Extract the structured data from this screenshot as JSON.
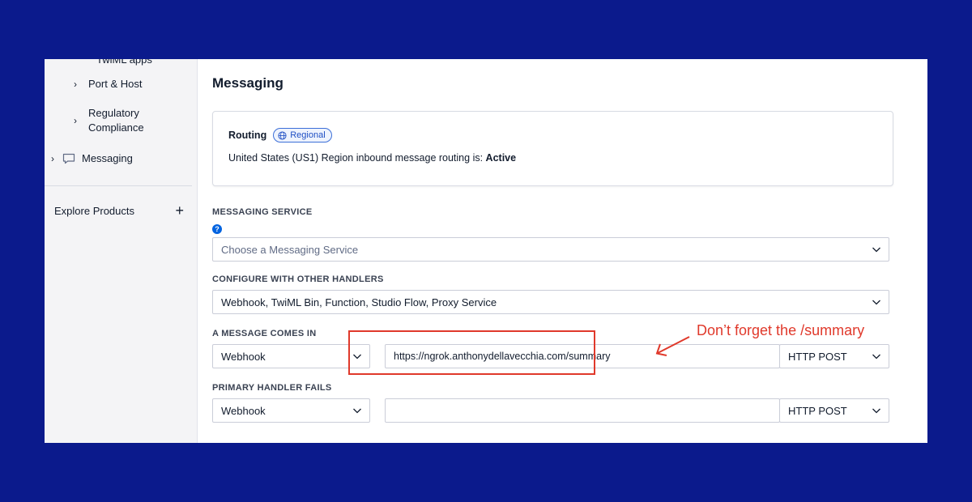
{
  "sidebar": {
    "cut_item": "TwiML apps",
    "items": [
      {
        "label": "Port & Host"
      },
      {
        "label_line1": "Regulatory",
        "label_line2": "Compliance"
      },
      {
        "label": "Messaging"
      }
    ],
    "explore": "Explore Products",
    "explore_icon": "+"
  },
  "main": {
    "title": "Messaging",
    "routing": {
      "title": "Routing",
      "badge": "Regional",
      "text": "United States (US1) Region inbound message routing is:",
      "status": "Active"
    },
    "messaging_service": {
      "label": "MESSAGING SERVICE",
      "placeholder": "Choose a Messaging Service"
    },
    "other_handlers": {
      "label": "CONFIGURE WITH OTHER HANDLERS",
      "value": "Webhook, TwiML Bin, Function, Studio Flow, Proxy Service"
    },
    "message_comes_in": {
      "label": "A MESSAGE COMES IN",
      "type": "Webhook",
      "url": "https://ngrok.anthonydellavecchia.com/summary",
      "method": "HTTP POST"
    },
    "primary_handler_fails": {
      "label": "PRIMARY HANDLER FAILS",
      "type": "Webhook",
      "url": "",
      "method": "HTTP POST"
    }
  },
  "annotation": {
    "text": "Don’t forget the /summary",
    "color": "#e0392b"
  },
  "colors": {
    "background": "#0b1a8c",
    "accent": "#0263e0"
  }
}
